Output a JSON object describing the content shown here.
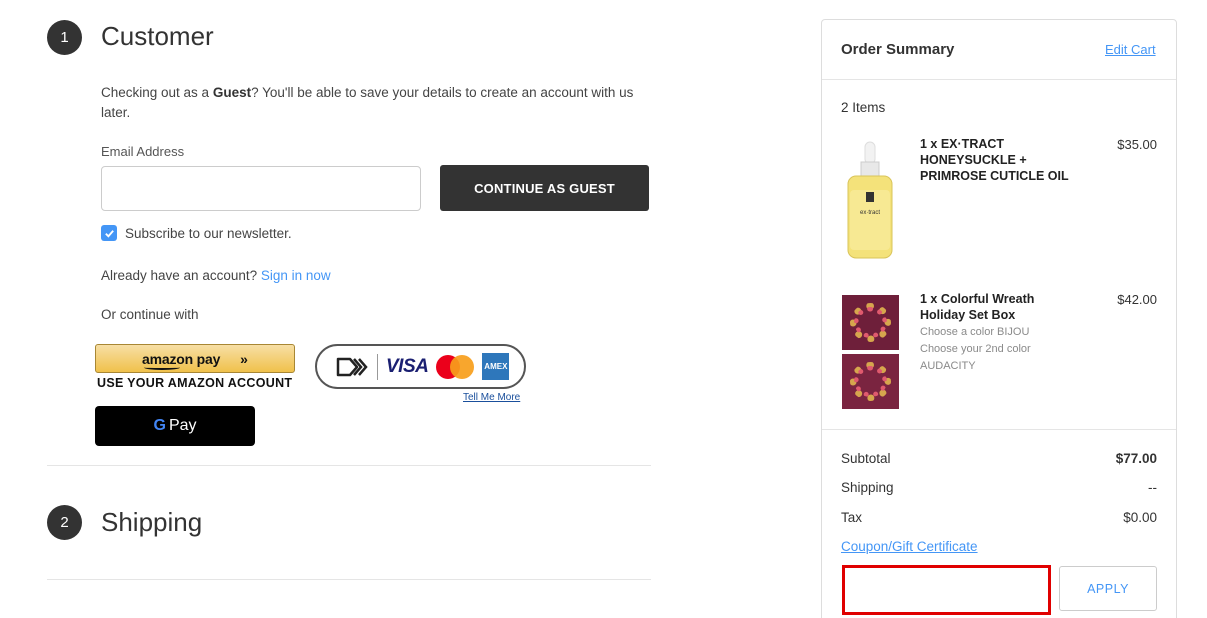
{
  "customer": {
    "step_number": "1",
    "title": "Customer",
    "guest_prefix": "Checking out as a ",
    "guest_bold": "Guest",
    "guest_suffix": "? You'll be able to save your details to create an account with us later.",
    "email_label": "Email Address",
    "email_value": "",
    "continue_button": "CONTINUE AS GUEST",
    "newsletter_label": "Subscribe to our newsletter.",
    "newsletter_checked": true,
    "account_prompt": "Already have an account?",
    "sign_in_link": "Sign in now",
    "or_continue": "Or continue with",
    "amazon_pay_logo": "amazon pay",
    "amazon_caption": "USE YOUR AMAZON ACCOUNT",
    "src_visa": "VISA",
    "src_amex": "AMEX",
    "tell_me_more": "Tell Me More",
    "gpay_g": "G",
    "gpay_text": "Pay"
  },
  "shipping": {
    "step_number": "2",
    "title": "Shipping"
  },
  "summary": {
    "title": "Order Summary",
    "edit_cart": "Edit Cart",
    "items_count": "2 Items",
    "items": [
      {
        "name": "1 x EX·TRACT HONEYSUCKLE + PRIMROSE CUTICLE OIL",
        "price": "$35.00",
        "options": []
      },
      {
        "name": "1 x Colorful Wreath Holiday Set Box",
        "price": "$42.00",
        "options": [
          "Choose a color BIJOU",
          "Choose your 2nd color AUDACITY"
        ]
      }
    ],
    "subtotal_label": "Subtotal",
    "subtotal_value": "$77.00",
    "shipping_label": "Shipping",
    "shipping_value": "--",
    "tax_label": "Tax",
    "tax_value": "$0.00",
    "coupon_link": "Coupon/Gift Certificate",
    "coupon_value": "",
    "apply_button": "APPLY"
  },
  "colors": {
    "accent": "#4496f6",
    "dark_button": "#333333",
    "highlight_border": "#e00000"
  }
}
